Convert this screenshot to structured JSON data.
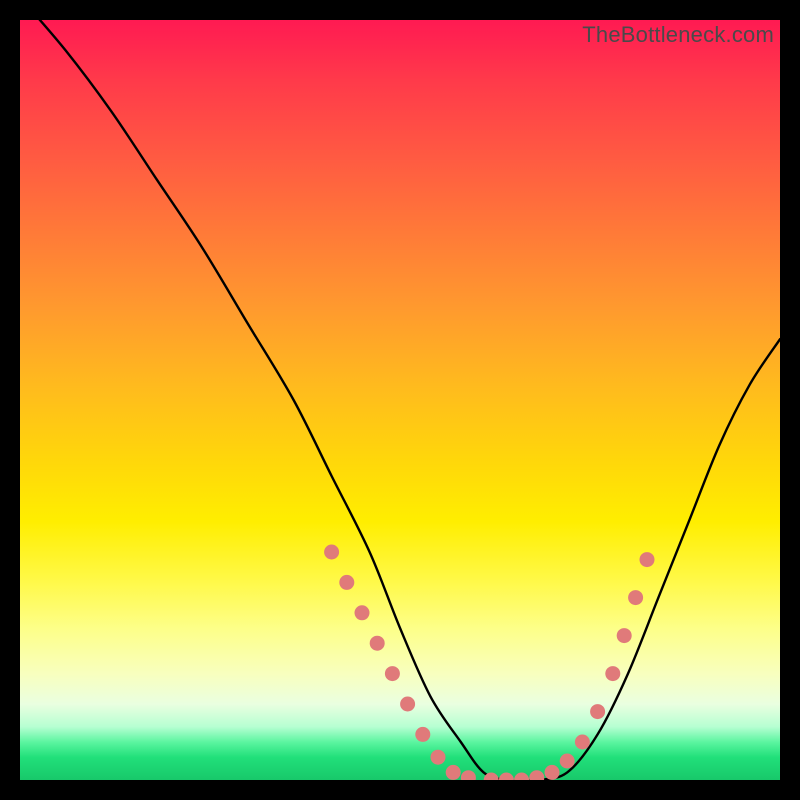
{
  "watermark": "TheBottleneck.com",
  "chart_data": {
    "type": "line",
    "title": "",
    "xlabel": "",
    "ylabel": "",
    "xlim": [
      0,
      100
    ],
    "ylim": [
      0,
      100
    ],
    "series": [
      {
        "name": "curve",
        "x": [
          0,
          6,
          12,
          18,
          24,
          30,
          36,
          41,
          46,
          50,
          54,
          58,
          61,
          64,
          68,
          72,
          76,
          80,
          84,
          88,
          92,
          96,
          100
        ],
        "values": [
          103,
          96,
          88,
          79,
          70,
          60,
          50,
          40,
          30,
          20,
          11,
          5,
          1,
          0,
          0,
          1,
          6,
          14,
          24,
          34,
          44,
          52,
          58
        ]
      }
    ],
    "markers": {
      "name": "scatter-left-right",
      "color": "#e07a7a",
      "points": [
        {
          "x": 41,
          "y": 30
        },
        {
          "x": 43,
          "y": 26
        },
        {
          "x": 45,
          "y": 22
        },
        {
          "x": 47,
          "y": 18
        },
        {
          "x": 49,
          "y": 14
        },
        {
          "x": 51,
          "y": 10
        },
        {
          "x": 53,
          "y": 6
        },
        {
          "x": 55,
          "y": 3
        },
        {
          "x": 57,
          "y": 1
        },
        {
          "x": 59,
          "y": 0.3
        },
        {
          "x": 62,
          "y": 0
        },
        {
          "x": 64,
          "y": 0
        },
        {
          "x": 66,
          "y": 0
        },
        {
          "x": 68,
          "y": 0.3
        },
        {
          "x": 70,
          "y": 1
        },
        {
          "x": 72,
          "y": 2.5
        },
        {
          "x": 74,
          "y": 5
        },
        {
          "x": 76,
          "y": 9
        },
        {
          "x": 78,
          "y": 14
        },
        {
          "x": 79.5,
          "y": 19
        },
        {
          "x": 81,
          "y": 24
        },
        {
          "x": 82.5,
          "y": 29
        }
      ]
    }
  }
}
